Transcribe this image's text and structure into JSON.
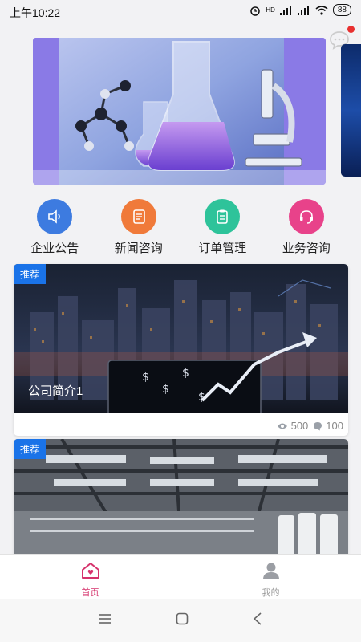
{
  "status_bar": {
    "time": "上午10:22",
    "signal_label": "HD",
    "battery": "88"
  },
  "banner": {
    "accent": "#8a7ae6"
  },
  "quick_nav": [
    {
      "label": "企业公告",
      "icon": "speaker-icon",
      "color": "#3d7be0"
    },
    {
      "label": "新闻咨询",
      "icon": "news-icon",
      "color": "#f07a3a"
    },
    {
      "label": "订单管理",
      "icon": "clipboard-icon",
      "color": "#2ec39a"
    },
    {
      "label": "业务咨询",
      "icon": "headset-icon",
      "color": "#e8428a"
    }
  ],
  "cards": [
    {
      "badge": "推荐",
      "title": "公司简介1",
      "views": "500",
      "comments": "100"
    },
    {
      "badge": "推荐"
    }
  ],
  "tab_bar": {
    "home_label": "首页",
    "mine_label": "我的",
    "active_color": "#d6336c"
  }
}
